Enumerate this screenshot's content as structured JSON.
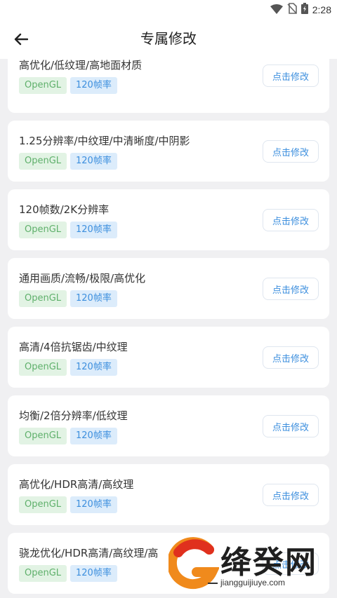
{
  "status_bar": {
    "time": "2:28",
    "icons": [
      "wifi-icon",
      "no-sim-icon",
      "battery-icon"
    ]
  },
  "header": {
    "title": "专属修改",
    "back_icon": "arrow-left-icon"
  },
  "cards": [
    {
      "title": "高优化/低纹理/高地面材质",
      "tag_api": "OpenGL",
      "tag_fps": "120帧率",
      "action": "点击修改"
    },
    {
      "title": "1.25分辨率/中纹理/中清晰度/中阴影",
      "tag_api": "OpenGL",
      "tag_fps": "120帧率",
      "action": "点击修改"
    },
    {
      "title": "120帧数/2K分辨率",
      "tag_api": "OpenGL",
      "tag_fps": "120帧率",
      "action": "点击修改"
    },
    {
      "title": "通用画质/流畅/极限/高优化",
      "tag_api": "OpenGL",
      "tag_fps": "120帧率",
      "action": "点击修改"
    },
    {
      "title": "高清/4倍抗锯齿/中纹理",
      "tag_api": "OpenGL",
      "tag_fps": "120帧率",
      "action": "点击修改"
    },
    {
      "title": "均衡/2倍分辨率/低纹理",
      "tag_api": "OpenGL",
      "tag_fps": "120帧率",
      "action": "点击修改"
    },
    {
      "title": "高优化/HDR高清/高纹理",
      "tag_api": "OpenGL",
      "tag_fps": "120帧率",
      "action": "点击修改"
    },
    {
      "title": "骁龙优化/HDR高清/高纹理/高",
      "tag_api": "OpenGL",
      "tag_fps": "120帧率",
      "action": "点击修改"
    }
  ],
  "watermark": {
    "name": "绛癸网",
    "url": "jiangguijiuye.com"
  },
  "colors": {
    "accent_blue": "#3d8fde",
    "tag_green": "#5fb06b",
    "background": "#f0f0f2"
  }
}
